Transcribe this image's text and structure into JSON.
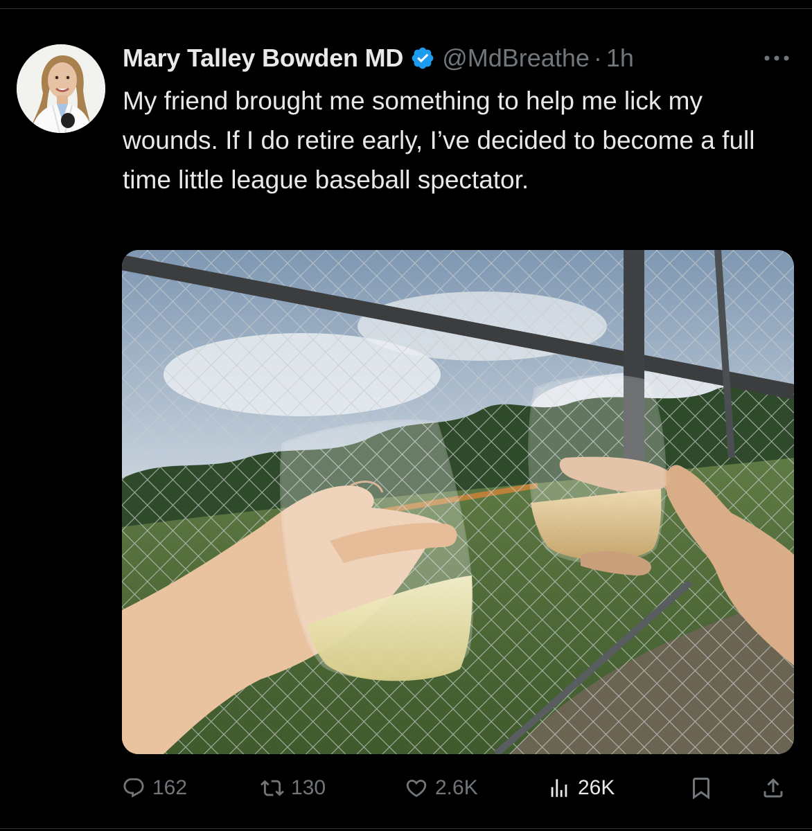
{
  "tweet": {
    "author_name": "Mary Talley Bowden MD",
    "handle": "@MdBreathe",
    "separator": "·",
    "time": "1h",
    "more_label": "···",
    "text": "My friend brought me something to help me lick my wounds. If I do retire early, I’ve decided to become a full time little league baseball spectator."
  },
  "actions": {
    "replies": "162",
    "reposts": "130",
    "likes": "2.6K",
    "views": "26K"
  },
  "icons": {
    "verified": "verified-badge-icon",
    "more": "more-options-icon",
    "reply": "reply-icon",
    "repost": "repost-icon",
    "like": "heart-icon",
    "views": "views-chart-icon",
    "bookmark": "bookmark-icon",
    "share": "share-icon"
  },
  "colors": {
    "background": "#000000",
    "text_primary": "#e7e9ea",
    "text_secondary": "#71767b",
    "verified_blue": "#1d9bf0"
  }
}
